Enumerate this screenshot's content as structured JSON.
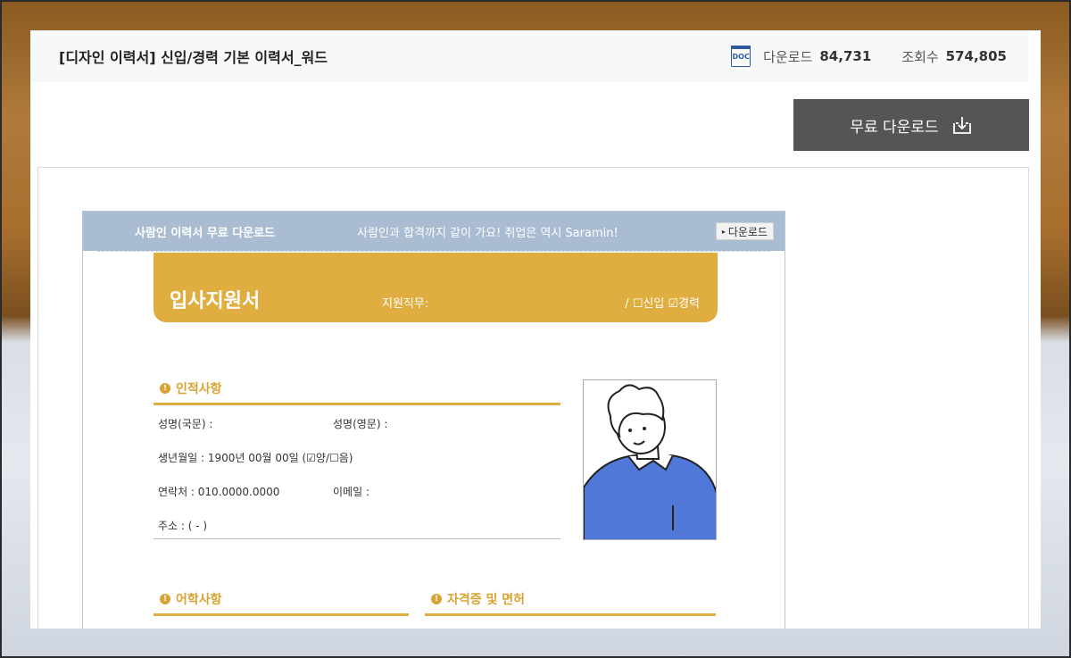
{
  "header": {
    "title": "[디자인 이력서] 신입/경력 기본 이력서_워드",
    "doc_icon_label": "DOC",
    "download_label": "다운로드",
    "download_count": "84,731",
    "views_label": "조회수",
    "views_count": "574,805"
  },
  "actions": {
    "free_download_label": "무료 다운로드"
  },
  "resume": {
    "banner": {
      "title": "사람인 이력서 무료 다운로드",
      "slogan": "사람인과 합격까지 같이 가요! 취업은 역시 Saramin!",
      "button_label": "다운로드"
    },
    "form_title": "입사지원서",
    "job_field_label": "지원직무:",
    "status_options": "/ ☐신입  ☑경력",
    "personal_section": {
      "title": "인적사항",
      "name_kr": "성명(국문) :",
      "name_en": "성명(영문) :",
      "birth": "생년월일 : 1900년 00월 00일 (☑양/☐음)",
      "phone": "연락처 : 010.0000.0000",
      "email": "이메일 :",
      "address": "주소 : (        -       )"
    },
    "education_section": {
      "title": "어학사항"
    },
    "license_section": {
      "title": "자격증 및 면허"
    }
  },
  "colors": {
    "accent": "#e0ae40",
    "banner": "#a9bcd1",
    "button": "#555555",
    "shirt": "#4f78d8"
  }
}
